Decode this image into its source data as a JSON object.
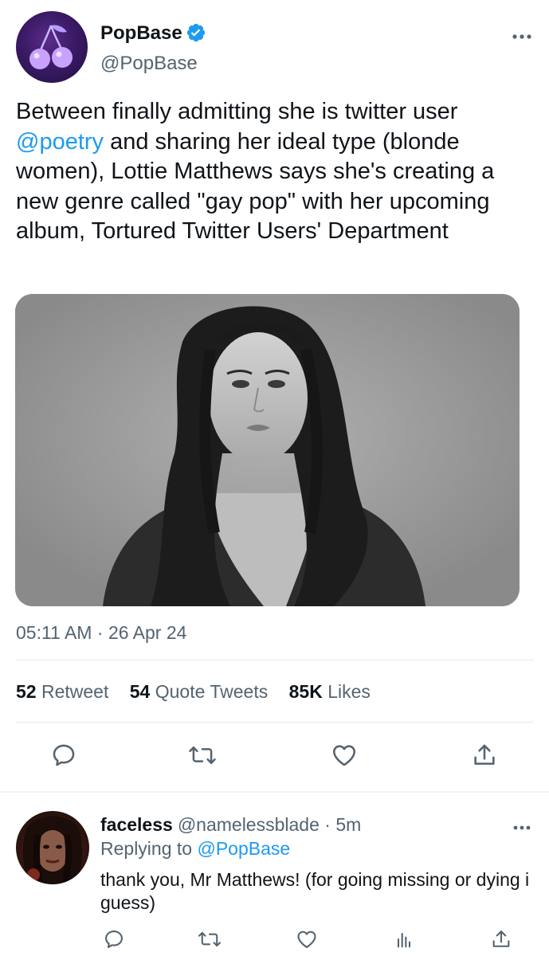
{
  "tweet": {
    "display_name": "PopBase",
    "handle": "@PopBase",
    "text_before_mention": "Between finally admitting she is twitter user ",
    "mention": "@poetry",
    "text_after_mention": " and sharing her ideal type (blonde women), Lottie Matthews says she's creating a new genre called \"gay pop\" with her upcoming album, Tortured Twitter Users' Department",
    "time": "05:11 AM",
    "date_separator": " · ",
    "date": "26 Apr 24",
    "stats": {
      "retweets_count": "52",
      "retweets_label": "Retweet",
      "quotes_count": "54",
      "quotes_label": "Quote Tweets",
      "likes_count": "85K",
      "likes_label": "Likes"
    },
    "icons": {
      "avatar": "cherries-logo",
      "verified": "verified-badge-icon",
      "more": "more-icon",
      "actions": [
        "reply-icon",
        "retweet-icon",
        "like-icon",
        "share-icon"
      ]
    }
  },
  "reply": {
    "display_name": "faceless",
    "handle": "@namelessblade",
    "time_separator": " · ",
    "time": "5m",
    "replying_prefix": "Replying to ",
    "replying_to": "@PopBase",
    "text": "thank you, Mr Matthews! (for going missing or dying i guess)",
    "icons": {
      "actions": [
        "reply-icon",
        "retweet-icon",
        "like-icon",
        "views-icon",
        "share-icon"
      ]
    }
  },
  "colors": {
    "accent": "#1d9bf0",
    "text_primary": "#0f1419",
    "text_secondary": "#536471",
    "divider": "#e6e9eb"
  }
}
